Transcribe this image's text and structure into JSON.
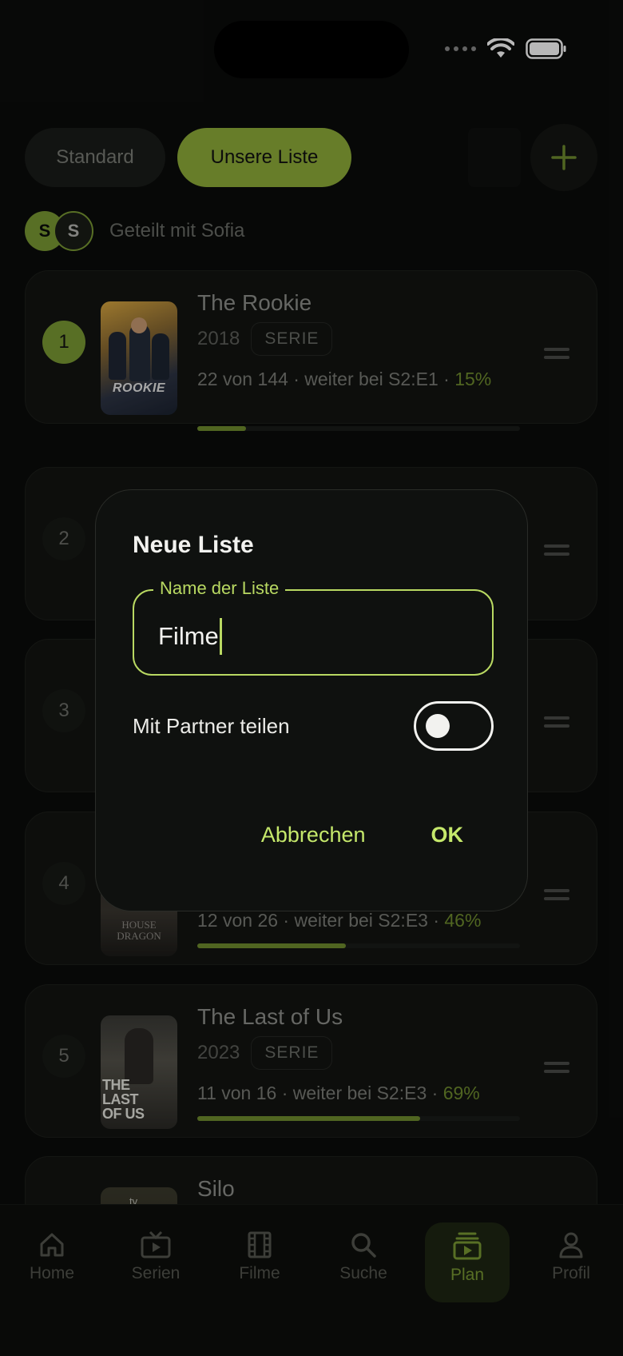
{
  "tabs": [
    {
      "label": "Standard",
      "active": false
    },
    {
      "label": "Unsere Liste",
      "active": true
    }
  ],
  "shared": {
    "avatars": [
      "S",
      "S"
    ],
    "text": "Geteilt mit Sofia"
  },
  "list": [
    {
      "rank": "1",
      "title": "The Rookie",
      "year": "2018",
      "type": "SERIE",
      "progress_text": "22 von 144 · weiter bei S2:E1 · ",
      "percent_label": "15%",
      "progress": 0.15,
      "poster_text": "ROOKIE"
    },
    {
      "rank": "2"
    },
    {
      "rank": "3"
    },
    {
      "rank": "4",
      "progress_text": "12 von 26 · weiter bei S2:E3 · ",
      "percent_label": "46%",
      "progress": 0.46,
      "poster_text": "HOUSE DRAGON"
    },
    {
      "rank": "5",
      "title": "The Last of Us",
      "year": "2023",
      "type": "SERIE",
      "progress_text": "11 von 16 · weiter bei S2:E3 · ",
      "percent_label": "69%",
      "progress": 0.69,
      "poster_text": "THE LAST OF US"
    },
    {
      "title": "Silo",
      "poster_text": "tv"
    }
  ],
  "nav": [
    {
      "label": "Home",
      "icon": "home-icon",
      "active": false
    },
    {
      "label": "Serien",
      "icon": "tv-icon",
      "active": false
    },
    {
      "label": "Filme",
      "icon": "film-icon",
      "active": false
    },
    {
      "label": "Suche",
      "icon": "search-icon",
      "active": false
    },
    {
      "label": "Plan",
      "icon": "plan-icon",
      "active": true
    },
    {
      "label": "Profil",
      "icon": "profile-icon",
      "active": false
    }
  ],
  "dialog": {
    "title": "Neue Liste",
    "field_label": "Name der Liste",
    "field_value": "Filme",
    "share_label": "Mit Partner teilen",
    "share_enabled": false,
    "cancel_label": "Abbrechen",
    "ok_label": "OK"
  },
  "colors": {
    "accent": "#8fae3a",
    "dialog_accent": "#b9d962",
    "background": "#0b0c0b"
  }
}
